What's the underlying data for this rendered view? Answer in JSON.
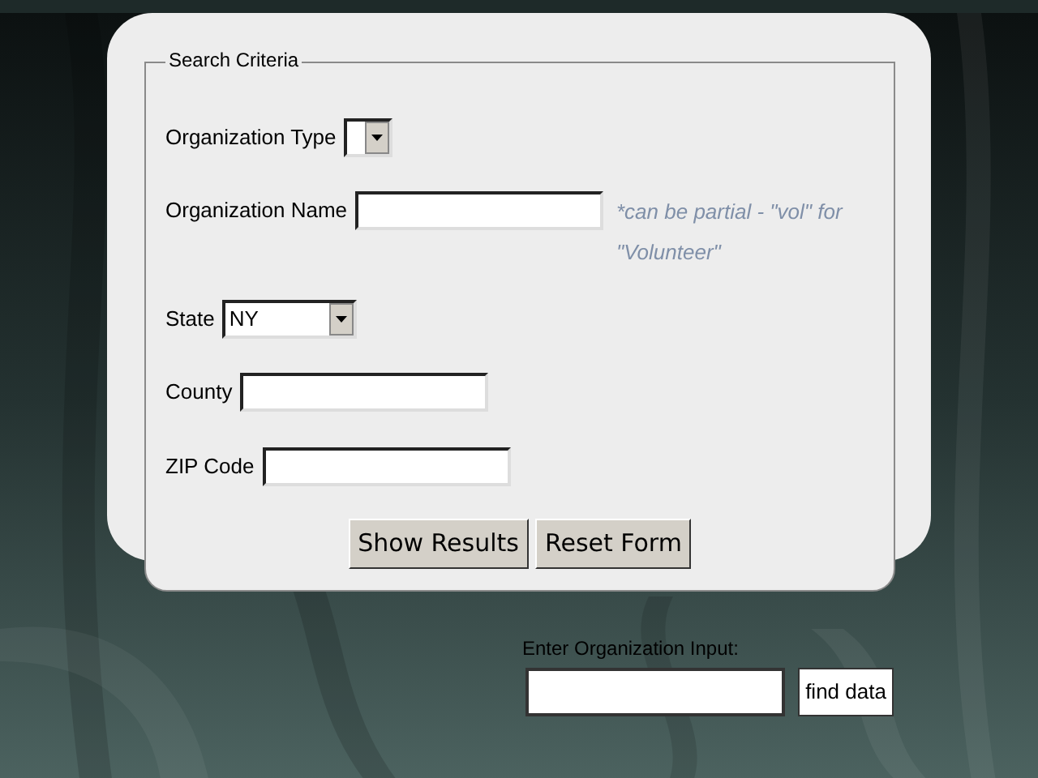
{
  "search_criteria": {
    "legend": "Search Criteria",
    "fields": [
      {
        "kind": "select",
        "label": "Organization Type"
      },
      {
        "kind": "text",
        "label": "Organization Name",
        "hint": "*can be partial - \"vol\" for \"Volunteer\""
      },
      {
        "kind": "select",
        "label": "State",
        "value": "NY"
      },
      {
        "kind": "text",
        "label": "County"
      },
      {
        "kind": "text",
        "label": "ZIP Code"
      }
    ],
    "buttons": [
      "Show Results",
      "Reset Form"
    ]
  },
  "lookup": {
    "label": "Enter Organization Input:",
    "button": "find data"
  }
}
